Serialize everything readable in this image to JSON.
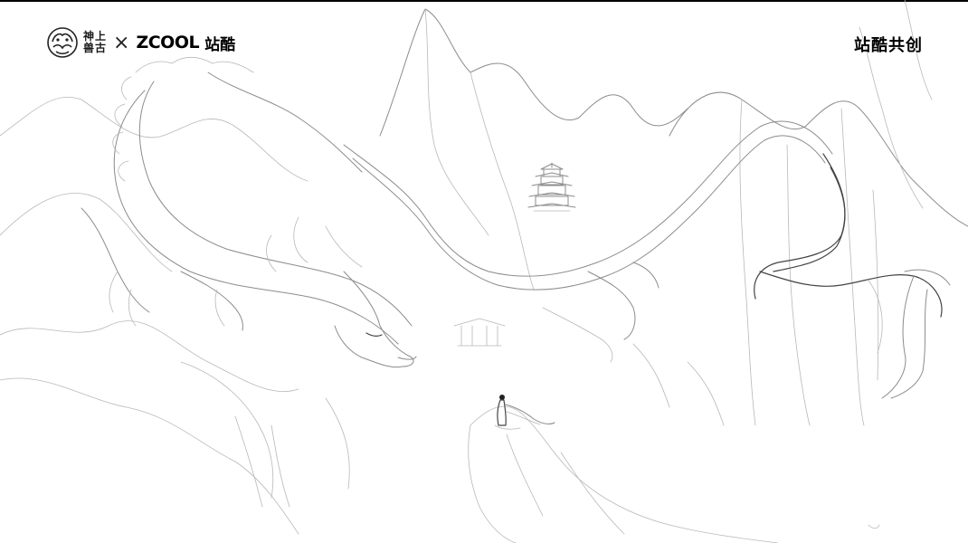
{
  "branding": {
    "partner_cn_line1": "神上",
    "partner_cn_line2": "兽古",
    "separator": "×",
    "zcool_latin": "ZCOOL",
    "zcool_cn": "站酷"
  },
  "cocreate_label": "站酷共创",
  "colors": {
    "background": "#ffffff",
    "ink": "#000000",
    "sketch_line": "#8a8a8a"
  },
  "artwork": {
    "subject_icons": [
      "dragon-icon",
      "mountain-icon",
      "pagoda-icon",
      "figure-icon"
    ]
  }
}
